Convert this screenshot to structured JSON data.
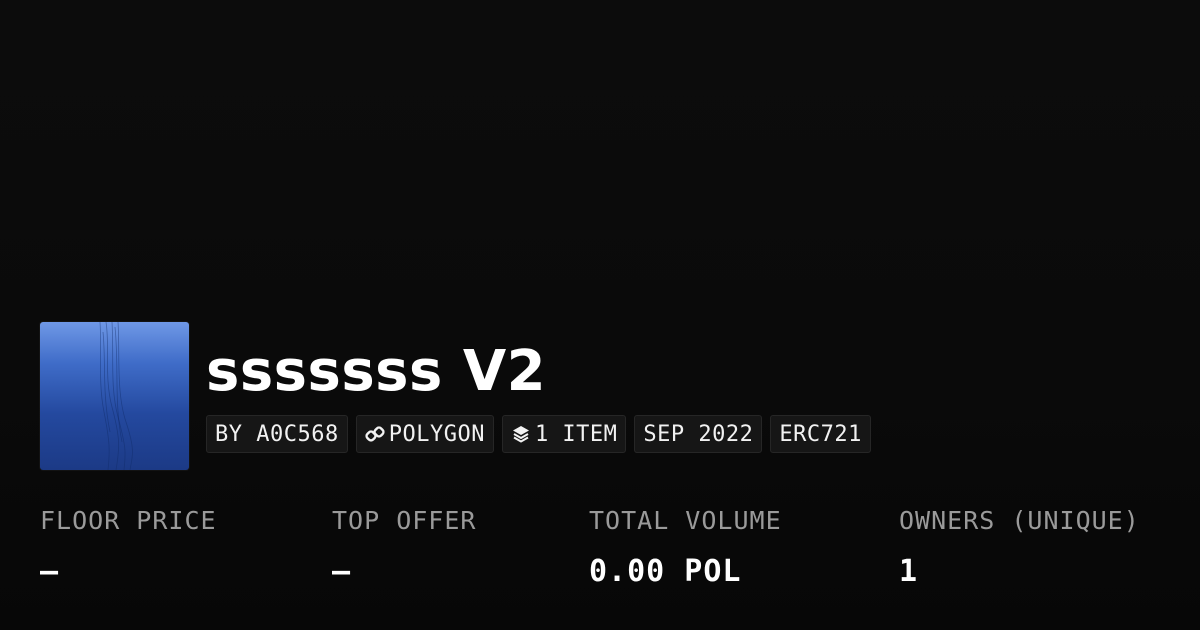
{
  "collection": {
    "name": "sssssss V2"
  },
  "tags": {
    "creator": "BY A0C568",
    "chain": "POLYGON",
    "items": "1 ITEM",
    "date": "SEP 2022",
    "standard": "ERC721"
  },
  "stats": {
    "floor": {
      "label": "FLOOR PRICE",
      "value": "–"
    },
    "top_offer": {
      "label": "TOP OFFER",
      "value": "–"
    },
    "volume": {
      "label": "TOTAL VOLUME",
      "value": "0.00 POL"
    },
    "owners": {
      "label": "OWNERS (UNIQUE)",
      "value": "1"
    }
  },
  "icons": {
    "chain": "link-icon",
    "items": "layers-icon"
  }
}
